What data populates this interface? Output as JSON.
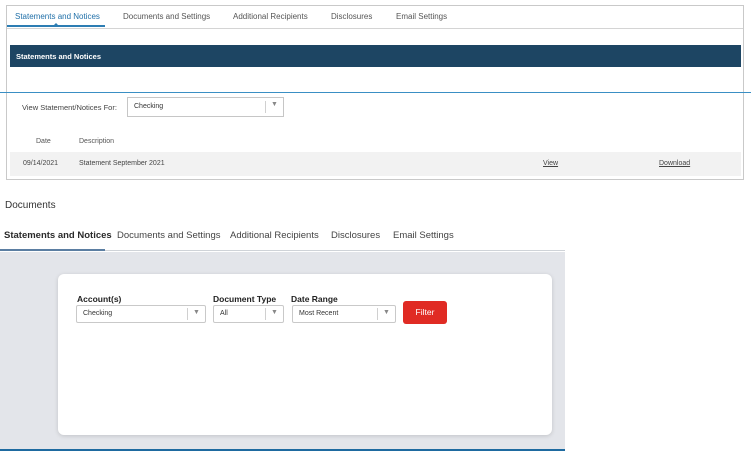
{
  "legacy": {
    "tabs": [
      "Statements and Notices",
      "Documents and Settings",
      "Additional Recipients",
      "Disclosures",
      "Email Settings"
    ],
    "section_title": "Statements and Notices",
    "view_label": "View Statement/Notices For:",
    "account_value": "Checking",
    "columns": [
      "Date",
      "Description"
    ],
    "rows": [
      {
        "date": "09/14/2021",
        "description": "Statement September 2021",
        "view": "View",
        "download": "Download"
      }
    ]
  },
  "modern": {
    "page_title": "Documents",
    "tabs": [
      "Statements and Notices",
      "Documents and Settings",
      "Additional Recipients",
      "Disclosures",
      "Email Settings"
    ],
    "filters": {
      "account_label": "Account(s)",
      "account_value": "Checking",
      "doctype_label": "Document Type",
      "doctype_value": "All",
      "range_label": "Date Range",
      "range_value": "Most Recent",
      "button": "Filter"
    }
  },
  "colors": {
    "header_bar": "#1d4563",
    "accent_blue": "#2d7db3",
    "filter_red": "#e02b24",
    "panel_gray": "#e3e5ea"
  }
}
